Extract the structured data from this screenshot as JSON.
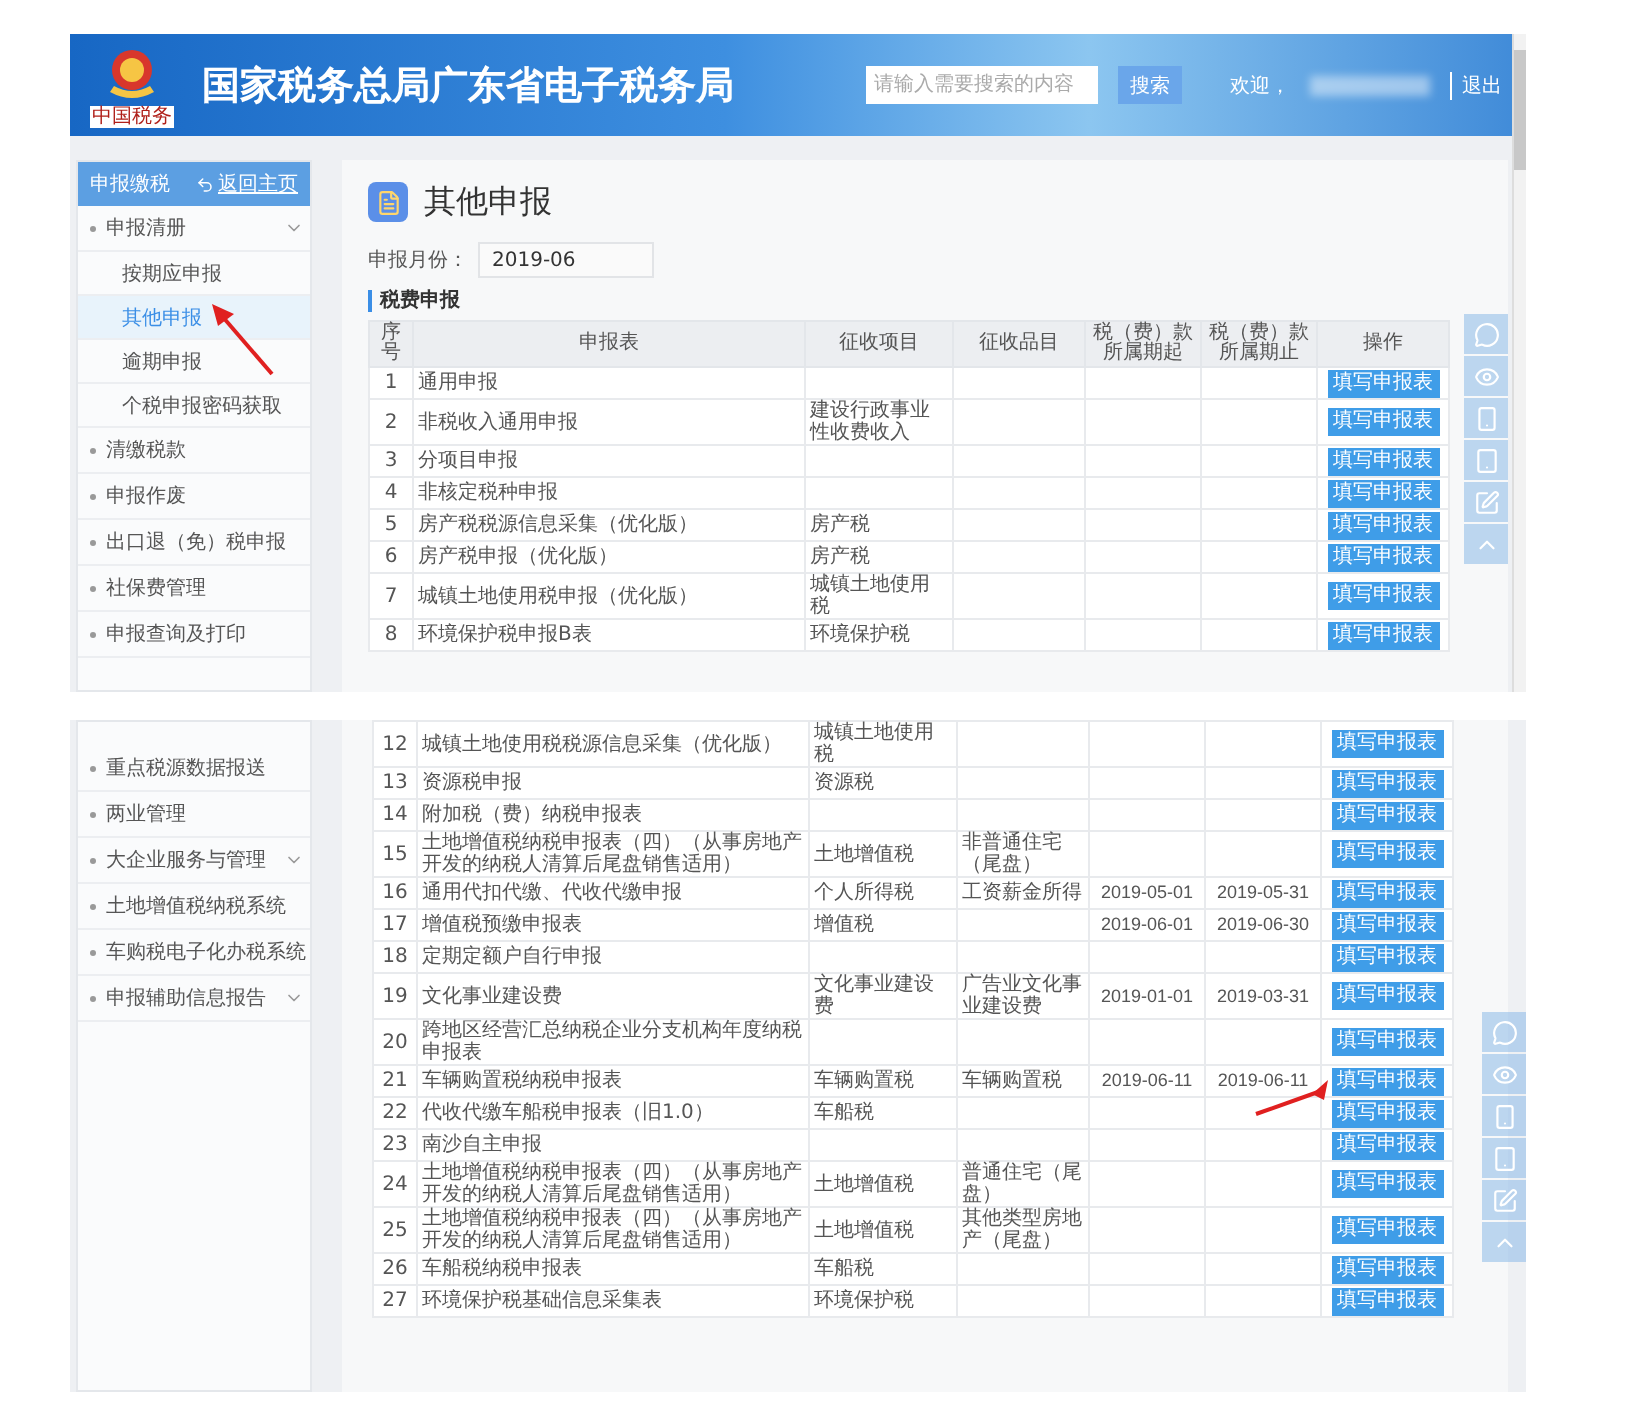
{
  "top_screen": {
    "header": {
      "logo_caption": "中国税务",
      "title": "国家税务总局广东省电子税务局",
      "search": {
        "placeholder": "请输入需要搜索的内容"
      },
      "search_button": "搜索",
      "welcome": "欢迎，",
      "logout": "退出"
    },
    "sidebar": {
      "title": "申报缴税",
      "back_link": "返回主页",
      "items": [
        {
          "kind": "menu",
          "label": "申报清册",
          "expanded": true,
          "children": [
            {
              "label": "按期应申报",
              "selected": false
            },
            {
              "label": "其他申报",
              "selected": true
            },
            {
              "label": "逾期申报",
              "selected": false
            },
            {
              "label": "个税申报密码获取",
              "selected": false
            }
          ]
        },
        {
          "kind": "link",
          "label": "清缴税款"
        },
        {
          "kind": "link",
          "label": "申报作废"
        },
        {
          "kind": "link",
          "label": "出口退（免）税申报"
        },
        {
          "kind": "link",
          "label": "社保费管理"
        },
        {
          "kind": "link",
          "label": "申报查询及打印"
        }
      ]
    },
    "page_title": "其他申报",
    "month_label": "申报月份：",
    "month_value": "2019-06",
    "section_title": "税费申报",
    "table": {
      "columns": [
        "序号",
        "申报表",
        "征收项目",
        "征收品目",
        "税（费）款所属期起",
        "税（费）款所属期止",
        "操作"
      ],
      "rows": [
        {
          "no": "1",
          "form": "通用申报",
          "action": "填写申报表"
        },
        {
          "no": "2",
          "form": "非税收入通用申报",
          "item": "建设行政事业性收费收入",
          "action": "填写申报表"
        },
        {
          "no": "3",
          "form": "分项目申报",
          "action": "填写申报表"
        },
        {
          "no": "4",
          "form": "非核定税种申报",
          "action": "填写申报表"
        },
        {
          "no": "5",
          "form": "房产税税源信息采集（优化版）",
          "item": "房产税",
          "action": "填写申报表"
        },
        {
          "no": "6",
          "form": "房产税申报（优化版）",
          "item": "房产税",
          "action": "填写申报表"
        },
        {
          "no": "7",
          "form": "城镇土地使用税申报（优化版）",
          "item": "城镇土地使用税",
          "action": "填写申报表"
        },
        {
          "no": "8",
          "form": "环境保护税申报B表",
          "item": "环境保护税",
          "action": "填写申报表"
        }
      ]
    }
  },
  "bottom_screen": {
    "sidebar": {
      "items": [
        {
          "kind": "link",
          "label": "重点税源数据报送"
        },
        {
          "kind": "link",
          "label": "两业管理"
        },
        {
          "kind": "menu",
          "label": "大企业服务与管理"
        },
        {
          "kind": "link",
          "label": "土地增值税纳税系统"
        },
        {
          "kind": "link",
          "label": "车购税电子化办税系统"
        },
        {
          "kind": "menu",
          "label": "申报辅助信息报告"
        }
      ]
    },
    "table": {
      "rows": [
        {
          "no": "12",
          "form": "城镇土地使用税税源信息采集（优化版）",
          "item": "城镇土地使用税",
          "action": "填写申报表"
        },
        {
          "no": "13",
          "form": "资源税申报",
          "item": "资源税",
          "action": "填写申报表"
        },
        {
          "no": "14",
          "form": "附加税（费）纳税申报表",
          "action": "填写申报表"
        },
        {
          "no": "15",
          "form": "土地增值税纳税申报表（四）（从事房地产开发的纳税人清算后尾盘销售适用）",
          "item": "土地增值税",
          "subitem": "非普通住宅（尾盘）",
          "action": "填写申报表"
        },
        {
          "no": "16",
          "form": "通用代扣代缴、代收代缴申报",
          "item": "个人所得税",
          "subitem": "工资薪金所得",
          "start": "2019-05-01",
          "end": "2019-05-31",
          "action": "填写申报表"
        },
        {
          "no": "17",
          "form": "增值税预缴申报表",
          "item": "增值税",
          "start": "2019-06-01",
          "end": "2019-06-30",
          "action": "填写申报表"
        },
        {
          "no": "18",
          "form": "定期定额户自行申报",
          "action": "填写申报表"
        },
        {
          "no": "19",
          "form": "文化事业建设费",
          "item": "文化事业建设费",
          "subitem": "广告业文化事业建设费",
          "start": "2019-01-01",
          "end": "2019-03-31",
          "action": "填写申报表"
        },
        {
          "no": "20",
          "form": "跨地区经营汇总纳税企业分支机构年度纳税申报表",
          "action": "填写申报表"
        },
        {
          "no": "21",
          "form": "车辆购置税纳税申报表",
          "item": "车辆购置税",
          "subitem": "车辆购置税",
          "start": "2019-06-11",
          "end": "2019-06-11",
          "action": "填写申报表"
        },
        {
          "no": "22",
          "form": "代收代缴车船税申报表（旧1.0）",
          "item": "车船税",
          "action": "填写申报表"
        },
        {
          "no": "23",
          "form": "南沙自主申报",
          "action": "填写申报表"
        },
        {
          "no": "24",
          "form": "土地增值税纳税申报表（四）（从事房地产开发的纳税人清算后尾盘销售适用）",
          "item": "土地增值税",
          "subitem": "普通住宅（尾盘）",
          "action": "填写申报表"
        },
        {
          "no": "25",
          "form": "土地增值税纳税申报表（四）（从事房地产开发的纳税人清算后尾盘销售适用）",
          "item": "土地增值税",
          "subitem": "其他类型房地产（尾盘）",
          "action": "填写申报表"
        },
        {
          "no": "26",
          "form": "车船税纳税申报表",
          "item": "车船税",
          "action": "填写申报表"
        },
        {
          "no": "27",
          "form": "环境保护税基础信息采集表",
          "item": "环境保护税",
          "action": "填写申报表"
        }
      ]
    }
  }
}
